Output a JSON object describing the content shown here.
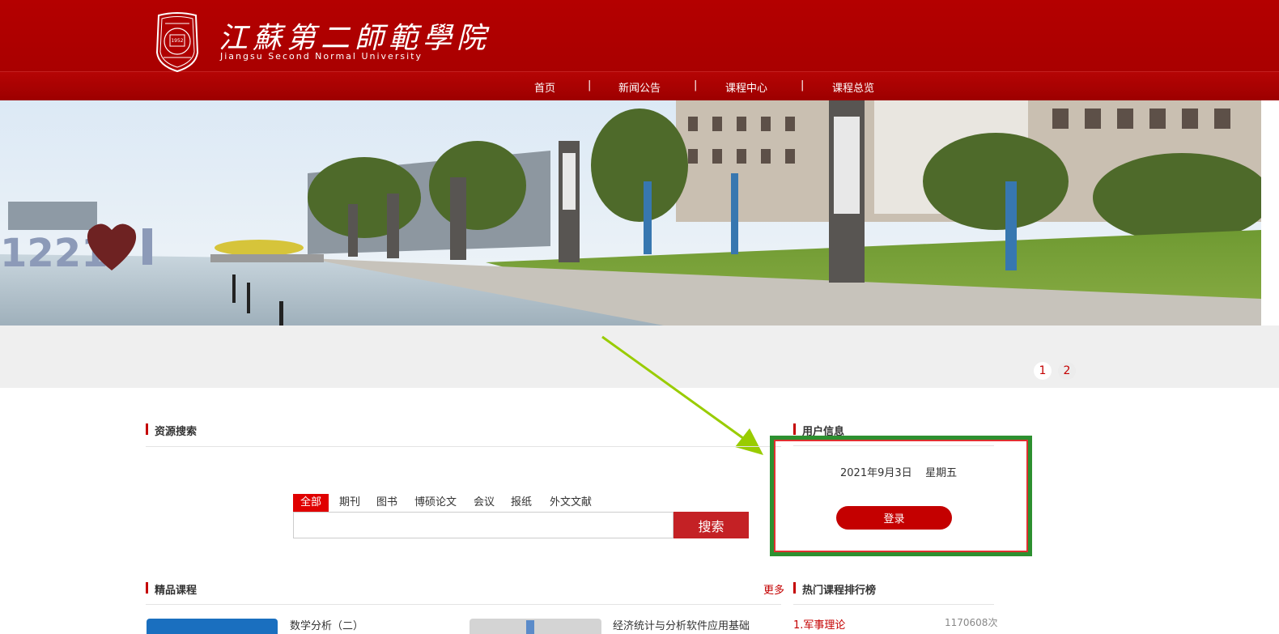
{
  "header": {
    "logo_cn": "江蘇第二師範學院",
    "logo_en": "Jiangsu Second Normal University",
    "seal_year": "1952"
  },
  "nav": {
    "items": [
      {
        "label": "首页"
      },
      {
        "label": "新闻公告"
      },
      {
        "label": "课程中心"
      },
      {
        "label": "课程总览"
      }
    ],
    "separator": "|"
  },
  "banner": {
    "pagination": [
      "1",
      "2"
    ],
    "sign_text": "1221"
  },
  "search": {
    "section_title": "资源搜索",
    "tabs": [
      "全部",
      "期刊",
      "图书",
      "博硕论文",
      "会议",
      "报纸",
      "外文文献"
    ],
    "active_tab": "全部",
    "input_value": "",
    "button_label": "搜索"
  },
  "user": {
    "section_title": "用户信息",
    "date": "2021年9月3日",
    "weekday": "星期五",
    "login_label": "登录"
  },
  "courses": {
    "section_title": "精品课程",
    "more_label": "更多",
    "items": [
      {
        "name": "数学分析（二）"
      },
      {
        "name": "经济统计与分析软件应用基础"
      }
    ]
  },
  "ranking": {
    "section_title": "热门课程排行榜",
    "items": [
      {
        "label": "1.军事理论",
        "count": "1170608次"
      }
    ]
  },
  "colors": {
    "brand_red": "#c40000",
    "header_red": "#b00000",
    "highlight_green": "#2d9030",
    "arrow_green": "#99cc00"
  }
}
